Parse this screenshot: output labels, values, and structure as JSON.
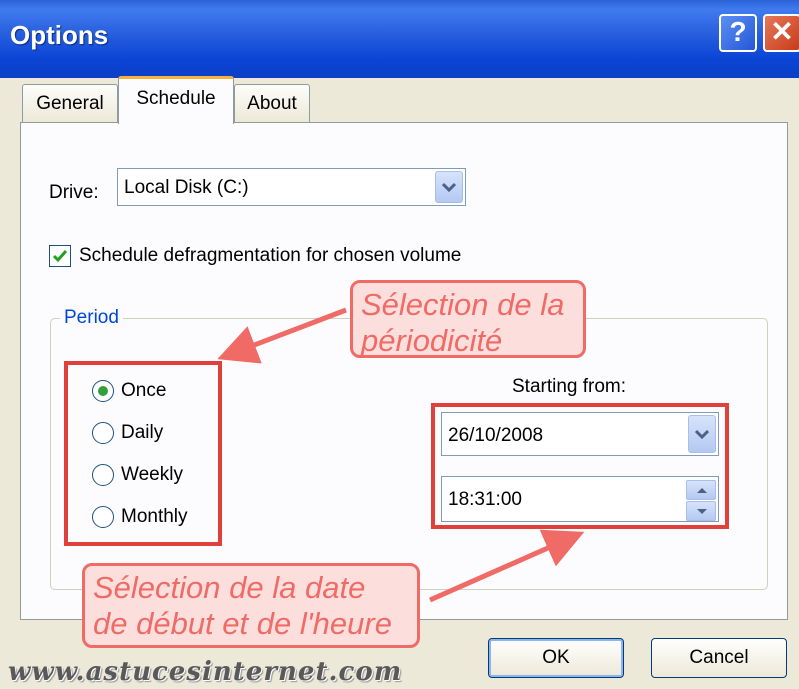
{
  "window": {
    "title": "Options",
    "help_label": "?",
    "close_label": "✕"
  },
  "tabs": [
    {
      "label": "General"
    },
    {
      "label": "Schedule",
      "selected": true
    },
    {
      "label": "About"
    }
  ],
  "drive": {
    "label": "Drive:",
    "value": "Local Disk (C:)"
  },
  "schedule_checkbox": {
    "label": "Schedule defragmentation for chosen volume",
    "checked": true
  },
  "period": {
    "label": "Period",
    "options": [
      {
        "label": "Once",
        "selected": true
      },
      {
        "label": "Daily",
        "selected": false
      },
      {
        "label": "Weekly",
        "selected": false
      },
      {
        "label": "Monthly",
        "selected": false
      }
    ]
  },
  "starting": {
    "label": "Starting from:",
    "date": "26/10/2008",
    "time": "18:31:00"
  },
  "annotations": {
    "period_callout": [
      "Sélection de la",
      "périodicité"
    ],
    "date_callout": [
      "Sélection de la date",
      "de début et de l'heure"
    ]
  },
  "buttons": {
    "ok": "OK",
    "cancel": "Cancel"
  },
  "watermark": "www.astucesinternet.com",
  "colors": {
    "accent_callout": "#f06a66",
    "highlight_box": "#e0403a",
    "group_label": "#0046d5",
    "radio_dot": "#2fa13a"
  }
}
